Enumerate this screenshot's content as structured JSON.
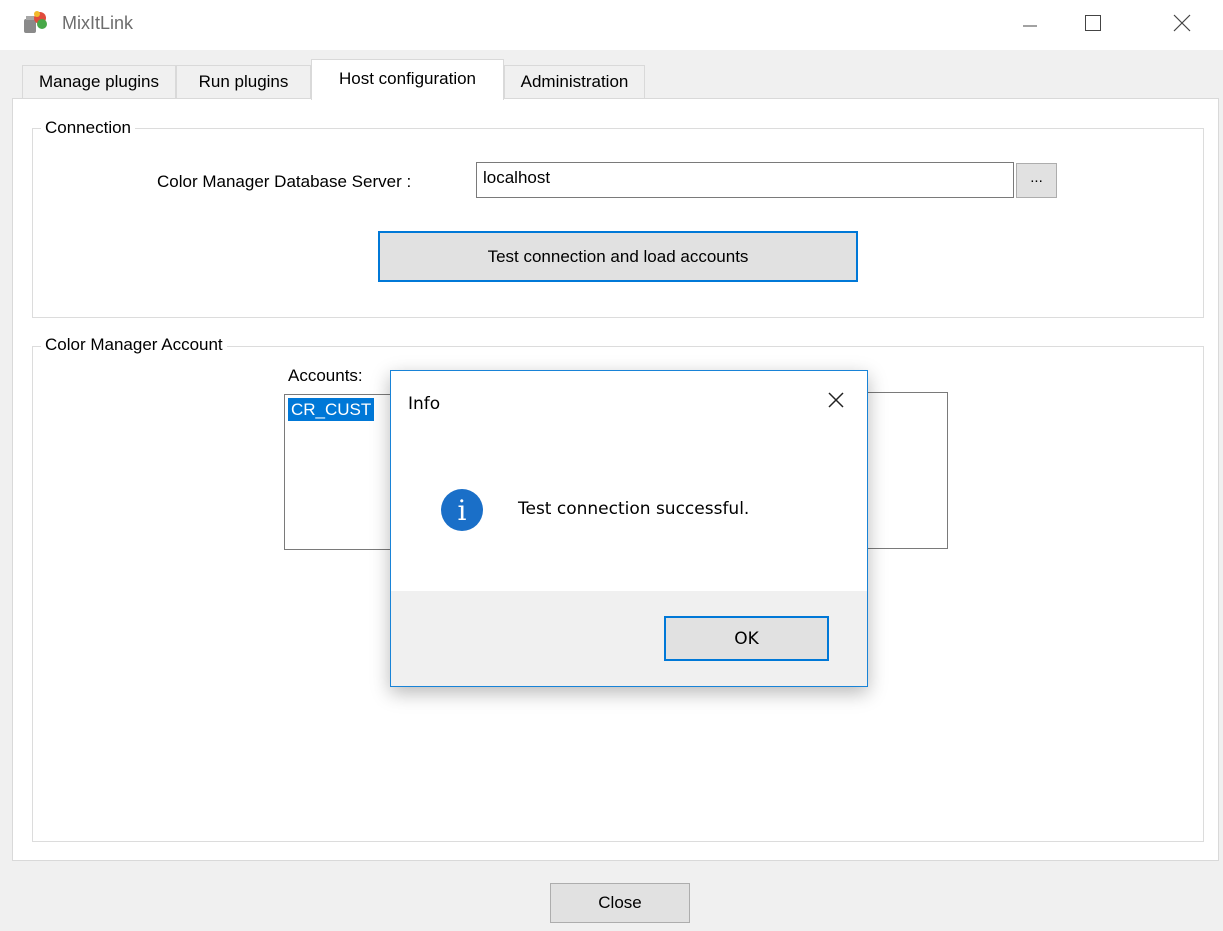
{
  "window": {
    "title": "MixItLink",
    "minimize_icon": "minimize-icon",
    "maximize_icon": "maximize-icon",
    "close_icon": "close-icon"
  },
  "tabs": [
    {
      "label": "Manage plugins",
      "active": false
    },
    {
      "label": "Run plugins",
      "active": false
    },
    {
      "label": "Host configuration",
      "active": true
    },
    {
      "label": "Administration",
      "active": false
    }
  ],
  "connection": {
    "legend": "Connection",
    "server_label": "Color Manager Database Server :",
    "server_value": "localhost",
    "browse_label": "...",
    "test_button": "Test connection and load accounts"
  },
  "account": {
    "legend": "Color Manager Account",
    "accounts_label": "Accounts:",
    "selected_account": "CR_CUST"
  },
  "footer": {
    "close_button": "Close"
  },
  "dialog": {
    "title": "Info",
    "message": "Test connection successful.",
    "icon": "info-icon",
    "icon_glyph": "i",
    "ok_button": "OK",
    "accent_color": "#0078d7"
  }
}
